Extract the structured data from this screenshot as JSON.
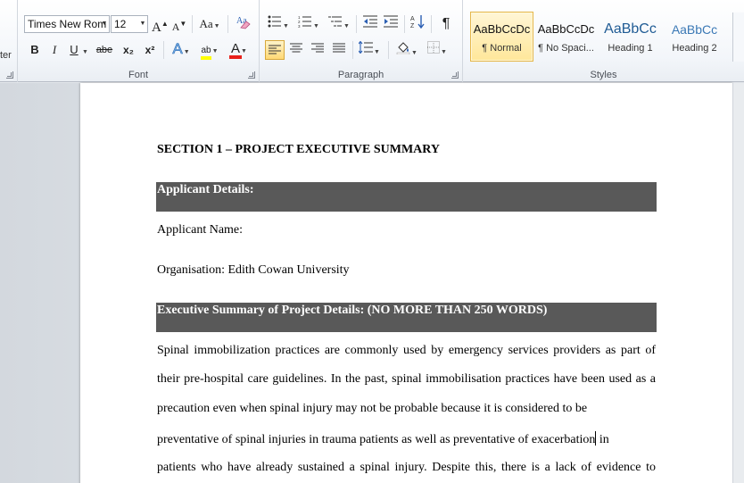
{
  "ribbon": {
    "clipboard_tail": "ter",
    "font": {
      "name": "Times New Rom",
      "size": "12",
      "grow_label": "A",
      "shrink_label": "A",
      "case_label": "Aa",
      "bold": "B",
      "italic": "I",
      "underline": "U",
      "strike": "abe",
      "subscript": "x₂",
      "superscript": "x²",
      "text_effect_label": "A",
      "highlight_label": "ab",
      "font_color_label": "A",
      "group_label": "Font"
    },
    "paragraph": {
      "pilcrow": "¶",
      "group_label": "Paragraph"
    },
    "styles": {
      "items": [
        {
          "preview": "AaBbCcDc",
          "name": "¶ Normal"
        },
        {
          "preview": "AaBbCcDc",
          "name": "¶ No Spaci..."
        },
        {
          "preview": "AaBbCc",
          "name": "Heading 1"
        },
        {
          "preview": "AaBbCc",
          "name": "Heading 2"
        }
      ],
      "group_label": "Styles"
    },
    "colors": {
      "highlight": "#ffff00",
      "font_color": "#e8201a",
      "selected_style": "#ffe79a"
    }
  },
  "document": {
    "section_title": "SECTION 1 – PROJECT EXECUTIVE  SUMMARY",
    "applicant_header": "Applicant Details:",
    "applicant_name": "Applicant Name:",
    "organisation": "Organisation:  Edith Cowan  University",
    "summary_header": "Executive Summary  of Project Details:  (NO MORE THAN 250 WORDS)",
    "body_lines": [
      "Spinal immobilization practices are commonly used by emergency services providers as part of",
      "their pre-hospital care guidelines.  In the past, spinal immobilisation practices have been used as a",
      "precaution even when spinal injury may not be probable because  it is considered  to be",
      "preventative of spinal injuries in trauma patients as well as preventative  of exacerbation",
      "patients who have already sustained  a spinal injury.  Despite this, there is a lack of evidence to"
    ],
    "line4_tail": " in",
    "shade_color": "#595959"
  }
}
